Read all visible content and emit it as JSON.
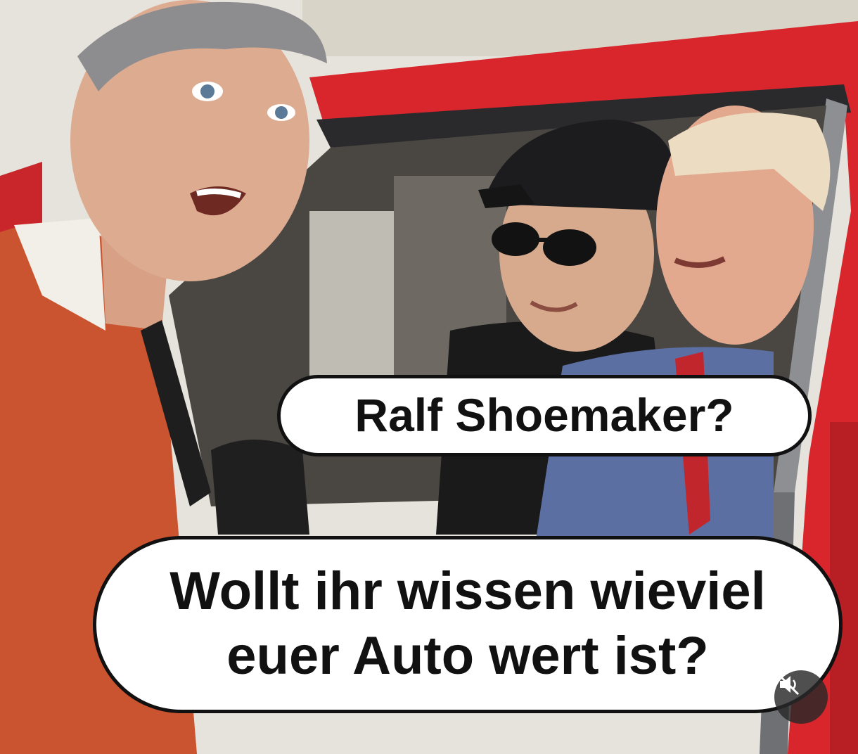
{
  "captions": {
    "question": "Ralf Shoemaker?",
    "line1": "Wollt ihr wissen wieviel",
    "line2": "euer Auto wert ist?"
  },
  "controls": {
    "mute_icon": "speaker-muted-icon"
  },
  "colors": {
    "car_red": "#d8262c",
    "sweater_orange": "#c9542f",
    "cap_black": "#1c1c1e",
    "suit_blue": "#5b6fa3"
  }
}
